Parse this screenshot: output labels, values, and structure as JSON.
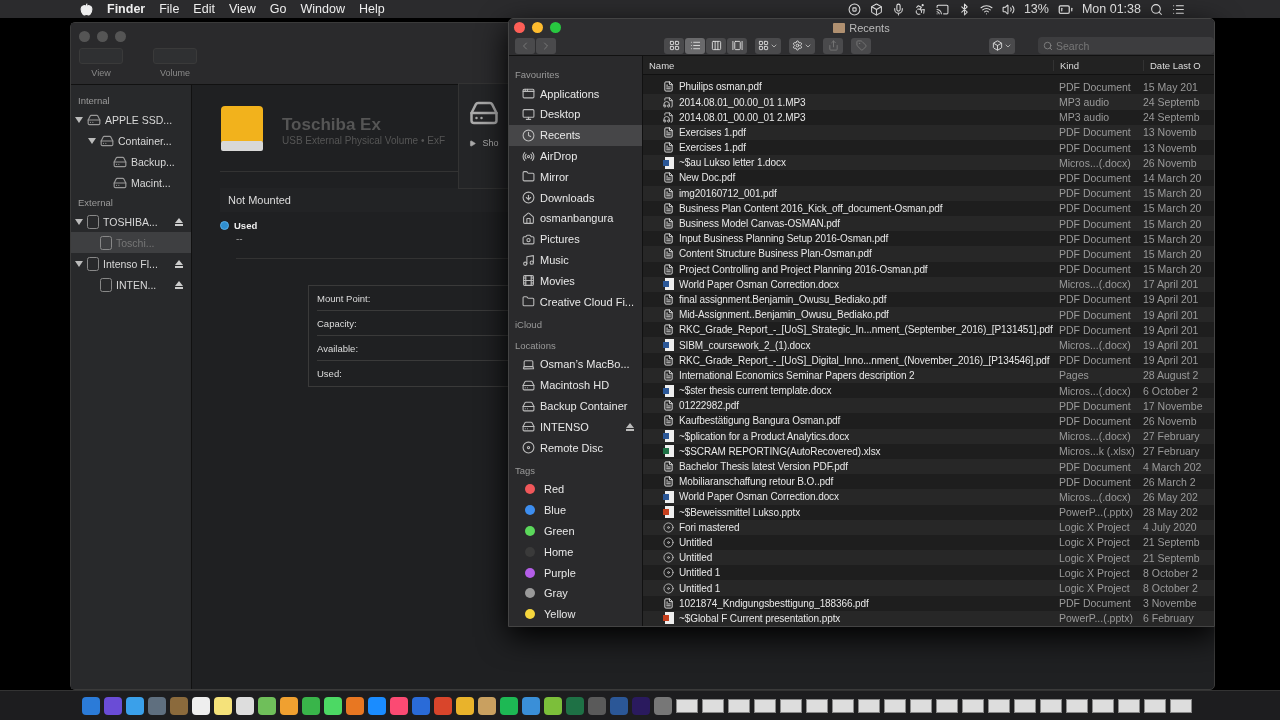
{
  "menu_bar": {
    "app": "Finder",
    "menus": [
      "File",
      "Edit",
      "View",
      "Go",
      "Window",
      "Help"
    ],
    "battery": "13%",
    "clock": "Mon 01:38"
  },
  "disk_utility": {
    "toolbar": [
      {
        "label": "View"
      },
      {
        "label": "Volume"
      }
    ],
    "sidebar": [
      {
        "heading": "Internal",
        "items": [
          {
            "label": "APPLE SSD...",
            "kind": "internal",
            "selected": false,
            "ejectable": false,
            "expanded": true,
            "children": [
              {
                "label": "Container...",
                "kind": "internal",
                "selected": false,
                "ejectable": false,
                "expanded": true,
                "children": [
                  {
                    "label": "Backup...",
                    "kind": "internal",
                    "selected": false,
                    "ejectable": false
                  },
                  {
                    "label": "Macint...",
                    "kind": "internal",
                    "selected": false,
                    "ejectable": false
                  }
                ]
              }
            ]
          }
        ]
      },
      {
        "heading": "External",
        "items": [
          {
            "label": "TOSHIBA...",
            "kind": "external",
            "selected": false,
            "ejectable": true,
            "expanded": true,
            "children": [
              {
                "label": "Toschi...",
                "kind": "external",
                "selected": true,
                "ejectable": false
              }
            ]
          },
          {
            "label": "Intenso Fl...",
            "kind": "external",
            "selected": false,
            "ejectable": true,
            "expanded": true,
            "children": [
              {
                "label": "INTEN...",
                "kind": "external",
                "selected": false,
                "ejectable": true
              }
            ]
          }
        ]
      }
    ],
    "volume": {
      "name": "Toschiba Ex",
      "subtitle": "USB External Physical Volume • ExF",
      "show_label": "Sho"
    },
    "status": "Not Mounted",
    "legend": {
      "label": "Used",
      "value": "--"
    },
    "info": [
      "Mount Point:",
      "Capacity:",
      "Available:",
      "Used:"
    ]
  },
  "finder": {
    "title": "Recents",
    "view_modes": [
      {
        "kind": "icons",
        "selected": false
      },
      {
        "kind": "list",
        "selected": true
      },
      {
        "kind": "columns",
        "selected": false
      },
      {
        "kind": "gallery",
        "selected": false
      }
    ],
    "search": {
      "placeholder": "Search"
    },
    "sidebar": [
      {
        "heading": "Favourites",
        "items": [
          {
            "label": "Applications",
            "kind": "apps",
            "selected": false
          },
          {
            "label": "Desktop",
            "kind": "desktop",
            "selected": false
          },
          {
            "label": "Recents",
            "kind": "recents",
            "selected": true
          },
          {
            "label": "AirDrop",
            "kind": "airdrop",
            "selected": false
          },
          {
            "label": "Mirror",
            "kind": "folder",
            "selected": false
          },
          {
            "label": "Downloads",
            "kind": "downloads",
            "selected": false
          },
          {
            "label": "osmanbangura",
            "kind": "home",
            "selected": false
          },
          {
            "label": "Pictures",
            "kind": "pictures",
            "selected": false
          },
          {
            "label": "Music",
            "kind": "music",
            "selected": false
          },
          {
            "label": "Movies",
            "kind": "movies",
            "selected": false
          },
          {
            "label": "Creative Cloud Fi...",
            "kind": "folder",
            "selected": false
          }
        ]
      },
      {
        "heading": "iCloud"
      },
      {
        "heading": "Locations",
        "items": [
          {
            "label": "Osman’s MacBo...",
            "kind": "laptop",
            "selected": false
          },
          {
            "label": "Macintosh HD",
            "kind": "disk",
            "selected": false
          },
          {
            "label": "Backup Container",
            "kind": "disk",
            "selected": false
          },
          {
            "label": "INTENSO",
            "kind": "disk",
            "selected": false,
            "ejectable": true
          },
          {
            "label": "Remote Disc",
            "kind": "disc",
            "selected": false
          }
        ]
      },
      {
        "heading": "Tags",
        "items": [
          {
            "label": "Red",
            "kind": "tag",
            "selected": false,
            "color": "#f0575a"
          },
          {
            "label": "Blue",
            "kind": "tag",
            "selected": false,
            "color": "#3d8ef0"
          },
          {
            "label": "Green",
            "kind": "tag",
            "selected": false,
            "color": "#5bd85b"
          },
          {
            "label": "Home",
            "kind": "tag",
            "selected": false,
            "color": "#3a3a3a"
          },
          {
            "label": "Purple",
            "kind": "tag",
            "selected": false,
            "color": "#b45ee8"
          },
          {
            "label": "Gray",
            "kind": "tag",
            "selected": false,
            "color": "#9a9a9a"
          },
          {
            "label": "Yellow",
            "kind": "tag",
            "selected": false,
            "color": "#f5d63d"
          }
        ]
      }
    ],
    "columns": [
      "Name",
      "Kind",
      "Date Last O"
    ],
    "rows": [
      {
        "kind": "pdf",
        "name": "Phuilips osman.pdf",
        "type": "PDF Document",
        "date": "15 May 201"
      },
      {
        "kind": "audio",
        "name": "2014.08.01_00.00_01 1.MP3",
        "type": "MP3 audio",
        "date": "24 Septemb"
      },
      {
        "kind": "audio",
        "name": "2014.08.01_00.00_01 2.MP3",
        "type": "MP3 audio",
        "date": "24 Septemb"
      },
      {
        "kind": "pdf",
        "name": "Exercises 1.pdf",
        "type": "PDF Document",
        "date": "13 Novemb"
      },
      {
        "kind": "pdf",
        "name": "Exercises 1.pdf",
        "type": "PDF Document",
        "date": "13 Novemb"
      },
      {
        "kind": "word",
        "name": "~$au Lukso  letter 1.docx",
        "type": "Micros...(.docx)",
        "date": "26 Novemb"
      },
      {
        "kind": "pdf",
        "name": "New Doc.pdf",
        "type": "PDF Document",
        "date": "14 March 20"
      },
      {
        "kind": "pdf",
        "name": "img20160712_001.pdf",
        "type": "PDF Document",
        "date": "15 March 20"
      },
      {
        "kind": "pdf",
        "name": "Business Plan Content 2016_Kick_off_document-Osman.pdf",
        "type": "PDF Document",
        "date": "15 March 20"
      },
      {
        "kind": "pdf",
        "name": "Business Model Canvas-OSMAN.pdf",
        "type": "PDF Document",
        "date": "15 March 20"
      },
      {
        "kind": "pdf",
        "name": "Input Business Planning Setup 2016-Osman.pdf",
        "type": "PDF Document",
        "date": "15 March 20"
      },
      {
        "kind": "pdf",
        "name": "Content Structure Business Plan-Osman.pdf",
        "type": "PDF Document",
        "date": "15 March 20"
      },
      {
        "kind": "pdf",
        "name": "Project Controlling and Project Planning 2016-Osman.pdf",
        "type": "PDF Document",
        "date": "15 March 20"
      },
      {
        "kind": "word",
        "name": "World Paper Osman Correction.docx",
        "type": "Micros...(.docx)",
        "date": "17 April 201"
      },
      {
        "kind": "pdf",
        "name": "final assignment.Benjamin_Owusu_Bediako.pdf",
        "type": "PDF Document",
        "date": "19 April 201"
      },
      {
        "kind": "pdf",
        "name": "Mid-Assignment..Benjamin_Owusu_Bediako.pdf",
        "type": "PDF Document",
        "date": "19 April 201"
      },
      {
        "kind": "pdf",
        "name": "RKC_Grade_Report_-_[UoS]_Strategic_In...nment_(September_2016)_[P131451].pdf",
        "type": "PDF Document",
        "date": "19 April 201"
      },
      {
        "kind": "word",
        "name": "SIBM_coursework_2_(1).docx",
        "type": "Micros...(.docx)",
        "date": "19 April 201"
      },
      {
        "kind": "pdf",
        "name": "RKC_Grade_Report_-_[UoS]_Digital_Inno...nment_(November_2016)_[P134546].pdf",
        "type": "PDF Document",
        "date": "19 April 201"
      },
      {
        "kind": "pages",
        "name": "International Economics Seminar Papers description 2",
        "type": "Pages",
        "date": "28 August 2"
      },
      {
        "kind": "word",
        "name": "~$ster thesis current template.docx",
        "type": "Micros...(.docx)",
        "date": "6 October 2"
      },
      {
        "kind": "pdf",
        "name": "01222982.pdf",
        "type": "PDF Document",
        "date": "17 Novembe"
      },
      {
        "kind": "pdf",
        "name": "Kaufbestätigung Bangura Osman.pdf",
        "type": "PDF Document",
        "date": "26 Novemb"
      },
      {
        "kind": "word",
        "name": "~$plication for a Product Analytics.docx",
        "type": "Micros...(.docx)",
        "date": "27 February"
      },
      {
        "kind": "excel",
        "name": "~$SCRAM REPORTING(AutoRecovered).xlsx",
        "type": "Micros...k (.xlsx)",
        "date": "27 February"
      },
      {
        "kind": "pdf",
        "name": "Bachelor Thesis latest Version PDF.pdf",
        "type": "PDF Document",
        "date": "4 March 202"
      },
      {
        "kind": "pdf",
        "name": "Mobiliaranschaffung retour B.O..pdf",
        "type": "PDF Document",
        "date": "26 March 2"
      },
      {
        "kind": "word",
        "name": "World Paper Osman Correction.docx",
        "type": "Micros...(.docx)",
        "date": "26 May 202"
      },
      {
        "kind": "powerpoint",
        "name": "~$Beweissmittel Lukso.pptx",
        "type": "PowerP...(.pptx)",
        "date": "28 May 202"
      },
      {
        "kind": "logic",
        "name": "Fori mastered",
        "type": "Logic X Project",
        "date": "4 July 2020"
      },
      {
        "kind": "logic",
        "name": "Untitled",
        "type": "Logic X Project",
        "date": "21 Septemb"
      },
      {
        "kind": "logic",
        "name": "Untitled",
        "type": "Logic X Project",
        "date": "21 Septemb"
      },
      {
        "kind": "logic",
        "name": "Untitled 1",
        "type": "Logic X Project",
        "date": "8 October 2"
      },
      {
        "kind": "logic",
        "name": "Untitled 1",
        "type": "Logic X Project",
        "date": "8 October 2"
      },
      {
        "kind": "pdf",
        "name": "1021874_Kndigungsbesttigung_188366.pdf",
        "type": "PDF Document",
        "date": "3 Novembe"
      },
      {
        "kind": "powerpoint",
        "name": "~$Global F Current presentation.pptx",
        "type": "PowerP...(.pptx)",
        "date": "6 February"
      }
    ]
  }
}
